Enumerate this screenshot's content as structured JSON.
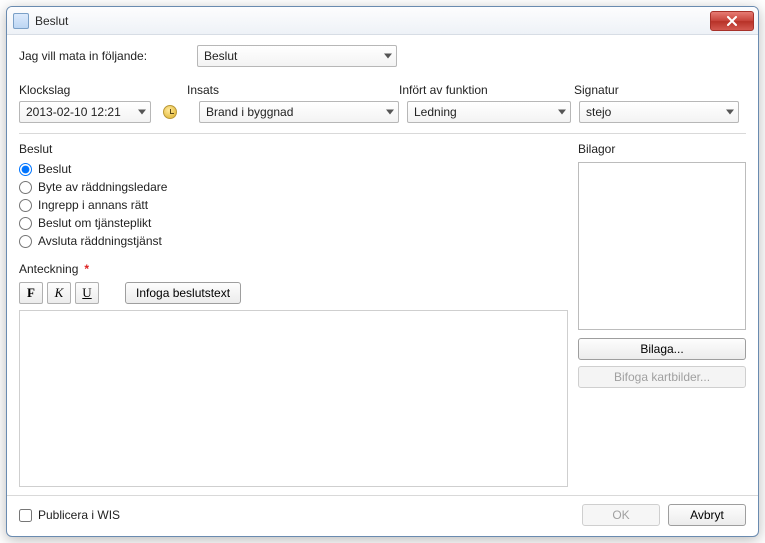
{
  "window": {
    "title": "Beslut"
  },
  "main": {
    "prompt": "Jag vill mata in följande:",
    "type_value": "Beslut"
  },
  "fields": {
    "klockslag_label": "Klockslag",
    "klockslag_value": "2013-02-10 12:21",
    "insats_label": "Insats",
    "insats_value": "Brand i byggnad",
    "infort_label": "Infört av funktion",
    "infort_value": "Ledning",
    "signatur_label": "Signatur",
    "signatur_value": "stejo"
  },
  "group": {
    "title": "Beslut",
    "options": [
      "Beslut",
      "Byte av räddningsledare",
      "Ingrepp i annans rätt",
      "Beslut om tjänsteplikt",
      "Avsluta räddningstjänst"
    ],
    "selected_index": 0
  },
  "anteckning": {
    "label": "Anteckning",
    "required_mark": "*",
    "bold_btn": "F",
    "italic_btn": "K",
    "underline_btn": "U",
    "insert_btn": "Infoga beslutstext",
    "text": ""
  },
  "bilagor": {
    "title": "Bilagor",
    "add_btn": "Bilaga...",
    "map_btn": "Bifoga kartbilder..."
  },
  "footer": {
    "publish_label": "Publicera i WIS",
    "ok": "OK",
    "cancel": "Avbryt"
  }
}
